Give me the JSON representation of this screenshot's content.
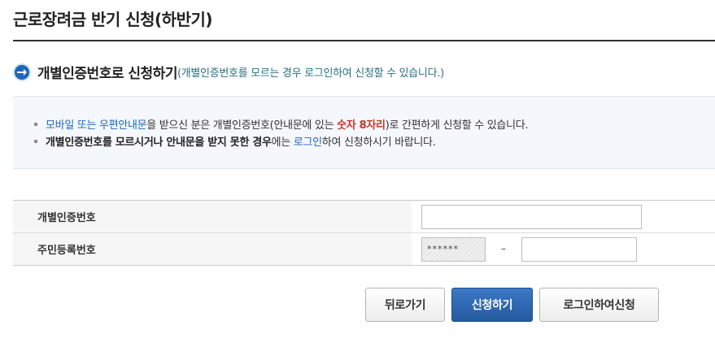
{
  "page": {
    "title": "근로장려금 반기 신청(하반기)"
  },
  "section": {
    "title": "개별인증번호로 신청하기",
    "note": "(개별인증번호를 모르는 경우 로그인하여 신청할 수 있습니다.)"
  },
  "info": {
    "line1": {
      "part1": "모바일 또는 우편안내문",
      "part2": "을 받으신 분은 개별인증번호(안내문에 있는 ",
      "part3": "숫자 8자리",
      "part4": ")로 간편하게 신청할 수 있습니다."
    },
    "line2": {
      "part1": "개별인증번호를 모르시거나 안내문을 받지 못한 경우",
      "part2": "에는 ",
      "part3": "로그인",
      "part4": "하여 신청하시기 바랍니다."
    }
  },
  "form": {
    "auth_label": "개별인증번호",
    "auth_value": "",
    "rrn_label": "주민등록번호",
    "rrn_front_masked": "******",
    "rrn_separator": "–",
    "rrn_back_value": ""
  },
  "buttons": {
    "back": "뒤로가기",
    "apply": "신청하기",
    "login_apply": "로그인하여신청"
  },
  "colors": {
    "accent_blue": "#1f66b8",
    "highlight_red": "#c0392b",
    "note_teal": "#2a6f80"
  },
  "icons": {
    "section_icon": "arrow-right-circle-icon"
  }
}
